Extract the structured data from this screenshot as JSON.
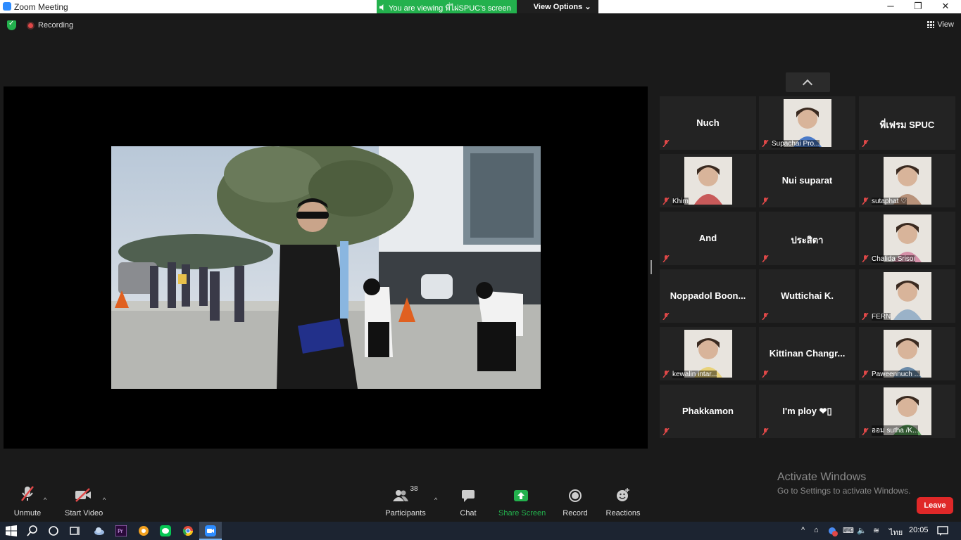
{
  "window": {
    "title": "Zoom Meeting",
    "minimize": "─",
    "maximize": "❐",
    "close": "✕"
  },
  "share_banner": {
    "text": "You are viewing พี่ไผ่SPUC's screen",
    "options": "View Options ⌄"
  },
  "topbar": {
    "recording": "Recording",
    "view": "View"
  },
  "participants": [
    {
      "name": "Nuch",
      "photo": false
    },
    {
      "name": "Supachai Pro...",
      "photo": true,
      "color": "#4a7ac8"
    },
    {
      "name": "พี่เฟรม SPUC",
      "photo": false
    },
    {
      "name": "Khim",
      "photo": true,
      "color": "#c85a5a"
    },
    {
      "name": "Nui suparat",
      "photo": false
    },
    {
      "name": "sutaphat ♡",
      "photo": true,
      "color": "#b8927a"
    },
    {
      "name": "And",
      "photo": false
    },
    {
      "name": "ประสิตา",
      "photo": false
    },
    {
      "name": "Chalida Srisoi",
      "photo": true,
      "color": "#d690a8"
    },
    {
      "name": "Noppadol Boon...",
      "photo": false
    },
    {
      "name": "Wuttichai K.",
      "photo": false
    },
    {
      "name": "FERN",
      "photo": true,
      "color": "#9ab2c8"
    },
    {
      "name": "kewalin intar...",
      "photo": true,
      "color": "#e8d27a"
    },
    {
      "name": "Kittinan Changr...",
      "photo": false
    },
    {
      "name": "Paweennuch ...",
      "photo": true,
      "color": "#6a8aa8"
    },
    {
      "name": "Phakkamon",
      "photo": false
    },
    {
      "name": "I'm ploy ❤▯",
      "photo": false
    },
    {
      "name": "ออม sutha /K...",
      "photo": true,
      "color": "#5aa05a"
    }
  ],
  "watermark": {
    "line1": "Activate Windows",
    "line2": "Go to Settings to activate Windows."
  },
  "controls": {
    "unmute": "Unmute",
    "start_video": "Start Video",
    "participants": "Participants",
    "participant_count": "38",
    "chat": "Chat",
    "share_screen": "Share Screen",
    "record": "Record",
    "reactions": "Reactions",
    "leave": "Leave"
  },
  "taskbar": {
    "language": "ไทย",
    "time": "20:05"
  },
  "colors": {
    "green": "#23b14d",
    "leave": "#e02828",
    "mute": "#e04848"
  }
}
